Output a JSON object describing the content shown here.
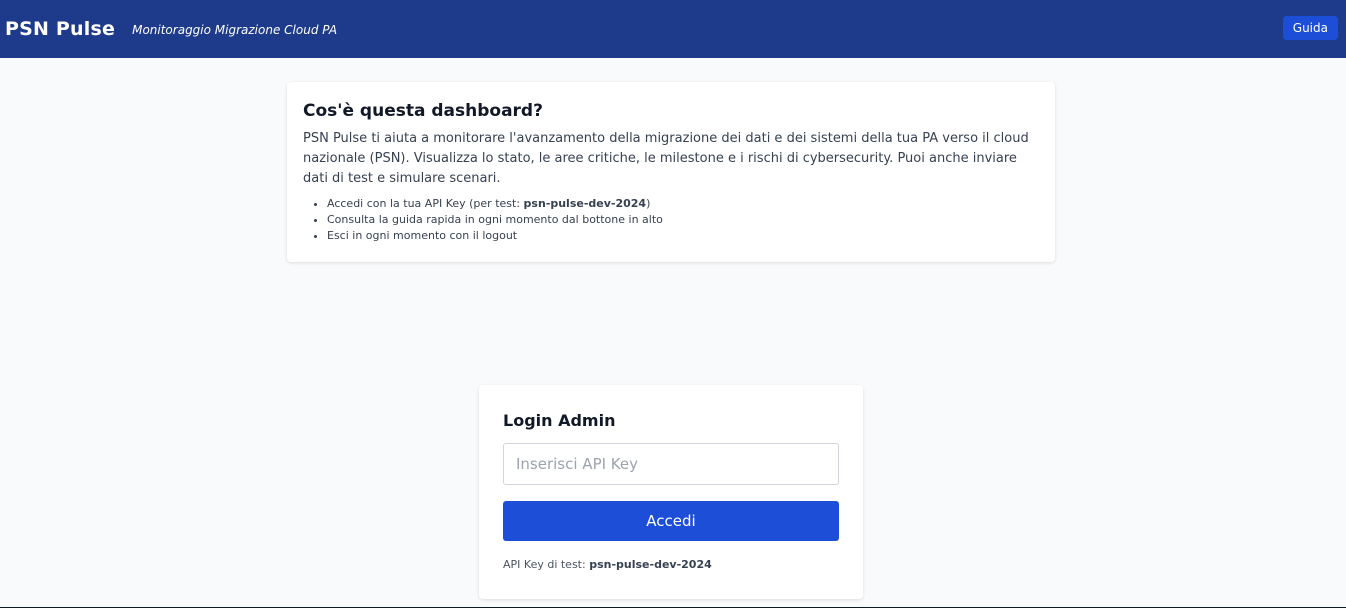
{
  "header": {
    "brand": "PSN Pulse",
    "subtitle": "Monitoraggio Migrazione Cloud PA",
    "guide_label": "Guida"
  },
  "info": {
    "title": "Cos'è questa dashboard?",
    "description": "PSN Pulse ti aiuta a monitorare l'avanzamento della migrazione dei dati e dei sistemi della tua PA verso il cloud nazionale (PSN). Visualizza lo stato, le aree critiche, le milestone e i rischi di cybersecurity. Puoi anche inviare dati di test e simulare scenari.",
    "bullets": {
      "item1_prefix": "Accedi con la tua API Key (per test: ",
      "item1_key": "psn-pulse-dev-2024",
      "item1_suffix": ")",
      "item2": "Consulta la guida rapida in ogni momento dal bottone in alto",
      "item3": "Esci in ogni momento con il logout"
    }
  },
  "login": {
    "title": "Login Admin",
    "input_placeholder": "Inserisci API Key",
    "input_value": "",
    "submit_label": "Accedi",
    "test_key_label": "API Key di test: ",
    "test_key_value": "psn-pulse-dev-2024"
  },
  "colors": {
    "header_bg": "#1e3a8a",
    "primary_button": "#1d4ed8",
    "page_bg": "#f8fafc"
  }
}
